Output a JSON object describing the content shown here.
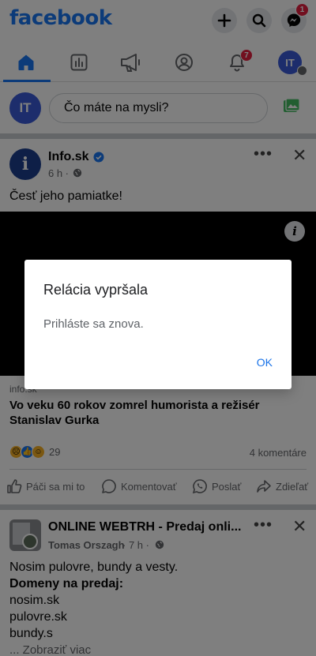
{
  "app": {
    "logo": "facebook",
    "messenger_badge": "1",
    "notifications_badge": "7",
    "profile_initials": "IT"
  },
  "nav": {
    "items": [
      "home-icon",
      "dashboard-icon",
      "megaphone-icon",
      "profile-icon",
      "bell-icon",
      "menu-avatar"
    ]
  },
  "composer": {
    "avatar_initials": "IT",
    "placeholder": "Čo máte na mysli?"
  },
  "post1": {
    "page_name": "Info.sk",
    "time": "6 h ·",
    "text": "Česť jeho pamiatke!",
    "link_domain": "info.sk",
    "link_title": "Vo veku 60 rokov zomrel humorista a režisér Stanislav Gurka",
    "reaction_count": "29",
    "comments": "4 komentáre",
    "actions": {
      "like": "Páči sa mi to",
      "comment": "Komentovať",
      "send": "Poslať",
      "share": "Zdieľať"
    }
  },
  "post2": {
    "group_name": "ONLINE WEBTRH - Predaj onli...",
    "author": "Tomas Orszagh",
    "time": "· 7 h ·",
    "lines": [
      "Nosim pulovre, bundy a vesty.",
      "Domeny na predaj:",
      "nosim.sk",
      "pulovre.sk",
      "bundy.s"
    ],
    "see_more": "... Zobraziť viac"
  },
  "dialog": {
    "title": "Relácia vypršala",
    "message": "Prihláste sa znova.",
    "ok_label": "OK"
  },
  "colors": {
    "brand": "#1877f2",
    "badge": "#e41e3f",
    "dialog_button": "#1a73e8"
  }
}
